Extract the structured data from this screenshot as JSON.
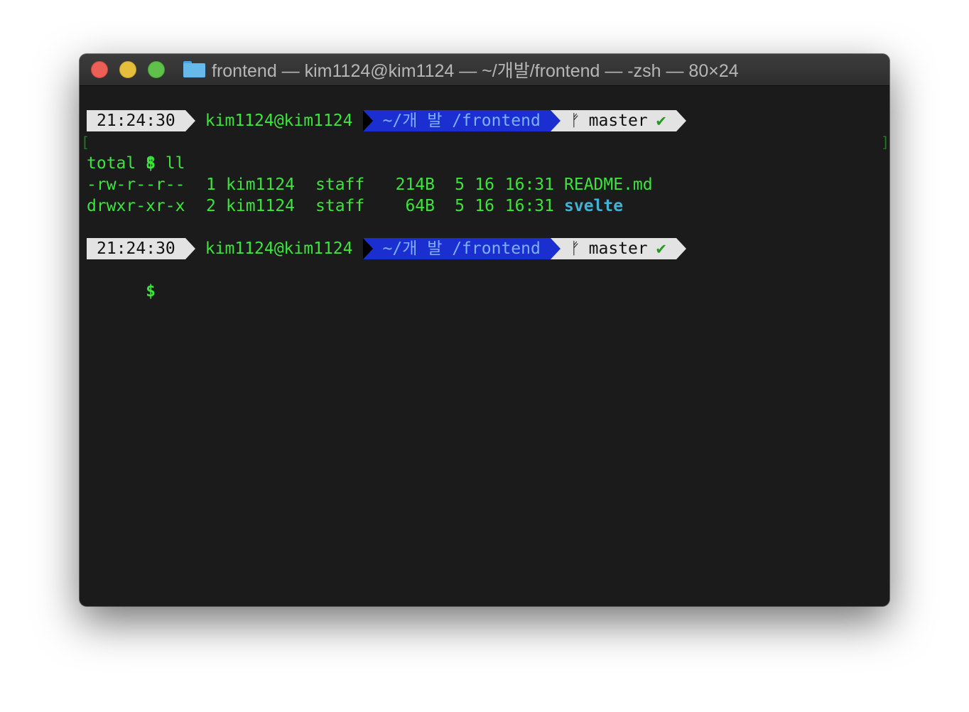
{
  "window": {
    "title": "frontend — kim1124@kim1124 — ~/개발/frontend — -zsh — 80×24",
    "title_icon": "folder-icon"
  },
  "colors": {
    "terminal_bg": "#1b1b1b",
    "text_green": "#3ce43c",
    "path_segment_bg": "#1b2fd0",
    "time_segment_bg": "#e3e3e3",
    "dir_cyan": "#3fb2d6",
    "close": "#ec5f56",
    "minimize": "#e5bf3c",
    "zoom": "#5fc04a"
  },
  "prompts": [
    {
      "time": "21:24:30",
      "user": "kim1124@kim1124",
      "path": "~/개 발 /frontend",
      "branch_icon": "git-branch-icon",
      "branch": "master",
      "status": "✔"
    },
    {
      "time": "21:24:30",
      "user": "kim1124@kim1124",
      "path": "~/개 발 /frontend",
      "branch_icon": "git-branch-icon",
      "branch": "master",
      "status": "✔"
    }
  ],
  "command": {
    "bracket_open": "[",
    "prompt_symbol": "$",
    "text": "ll",
    "bracket_close": "]"
  },
  "output": {
    "total": "total 8",
    "entries": [
      {
        "perms": "-rw-r--r--",
        "links": "1",
        "owner": "kim1124",
        "group": "staff",
        "size": "214B",
        "month": "5",
        "day": "16",
        "time": "16:31",
        "name": "README.md"
      },
      {
        "perms": "drwxr-xr-x",
        "links": "2",
        "owner": "kim1124",
        "group": "staff",
        "size": "64B",
        "month": "5",
        "day": "16",
        "time": "16:31",
        "name": "svelte"
      }
    ]
  },
  "cursor_prompt": "$"
}
